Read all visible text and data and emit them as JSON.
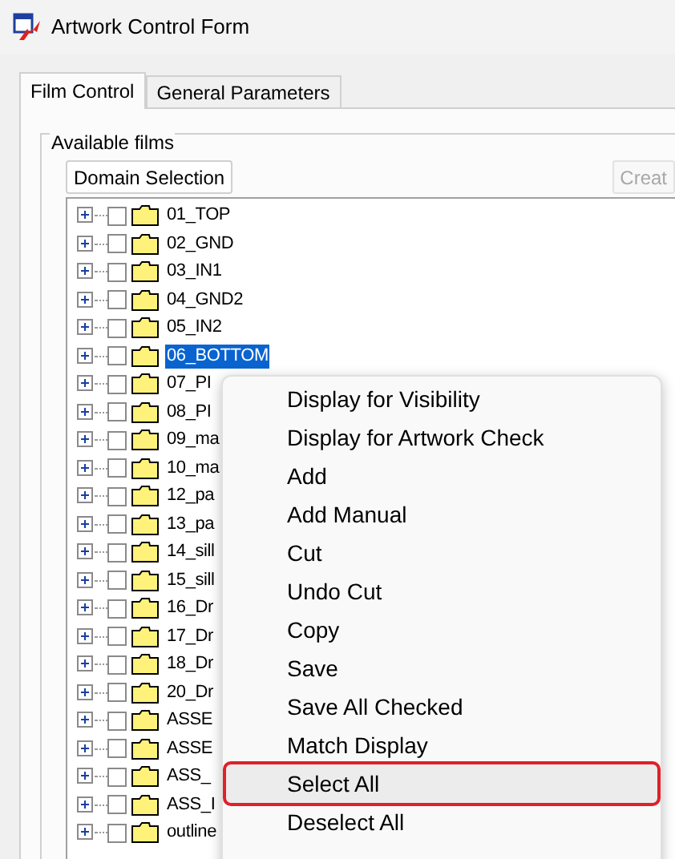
{
  "window": {
    "title": "Artwork Control Form"
  },
  "tabs": [
    {
      "label": "Film Control",
      "selected": true
    },
    {
      "label": "General Parameters",
      "selected": false
    }
  ],
  "group": {
    "title": "Available films"
  },
  "buttons": [
    {
      "label": "Domain Selection",
      "disabled": false
    },
    {
      "label": "Creat",
      "disabled": true
    }
  ],
  "tree": {
    "items": [
      {
        "label": "01_TOP",
        "checked": false,
        "selected": false
      },
      {
        "label": "02_GND",
        "checked": false,
        "selected": false
      },
      {
        "label": "03_IN1",
        "checked": false,
        "selected": false
      },
      {
        "label": "04_GND2",
        "checked": false,
        "selected": false
      },
      {
        "label": "05_IN2",
        "checked": false,
        "selected": false
      },
      {
        "label": "06_BOTTOM",
        "checked": false,
        "selected": true
      },
      {
        "label": "07_PI",
        "checked": false,
        "selected": false
      },
      {
        "label": "08_PI",
        "checked": false,
        "selected": false
      },
      {
        "label": "09_ma",
        "checked": false,
        "selected": false
      },
      {
        "label": "10_ma",
        "checked": false,
        "selected": false
      },
      {
        "label": "12_pa",
        "checked": false,
        "selected": false
      },
      {
        "label": "13_pa",
        "checked": false,
        "selected": false
      },
      {
        "label": "14_sill",
        "checked": false,
        "selected": false
      },
      {
        "label": "15_sill",
        "checked": false,
        "selected": false
      },
      {
        "label": "16_Dr",
        "checked": false,
        "selected": false
      },
      {
        "label": "17_Dr",
        "checked": false,
        "selected": false
      },
      {
        "label": "18_Dr",
        "checked": false,
        "selected": false
      },
      {
        "label": "20_Dr",
        "checked": false,
        "selected": false
      },
      {
        "label": "ASSE",
        "checked": false,
        "selected": false
      },
      {
        "label": "ASSE",
        "checked": false,
        "selected": false
      },
      {
        "label": "ASS_",
        "checked": false,
        "selected": false
      },
      {
        "label": "ASS_I",
        "checked": false,
        "selected": false
      },
      {
        "label": "outline",
        "checked": false,
        "selected": false
      }
    ]
  },
  "context_menu": {
    "items": [
      {
        "label": "Display for Visibility",
        "highlighted": false
      },
      {
        "label": "Display for Artwork Check",
        "highlighted": false
      },
      {
        "label": "Add",
        "highlighted": false
      },
      {
        "label": "Add Manual",
        "highlighted": false
      },
      {
        "label": "Cut",
        "highlighted": false
      },
      {
        "label": "Undo Cut",
        "highlighted": false
      },
      {
        "label": "Copy",
        "highlighted": false
      },
      {
        "label": "Save",
        "highlighted": false
      },
      {
        "label": "Save All Checked",
        "highlighted": false
      },
      {
        "label": "Match Display",
        "highlighted": false
      },
      {
        "label": "Select All",
        "highlighted": true
      },
      {
        "label": "Deselect All",
        "highlighted": false
      }
    ]
  }
}
